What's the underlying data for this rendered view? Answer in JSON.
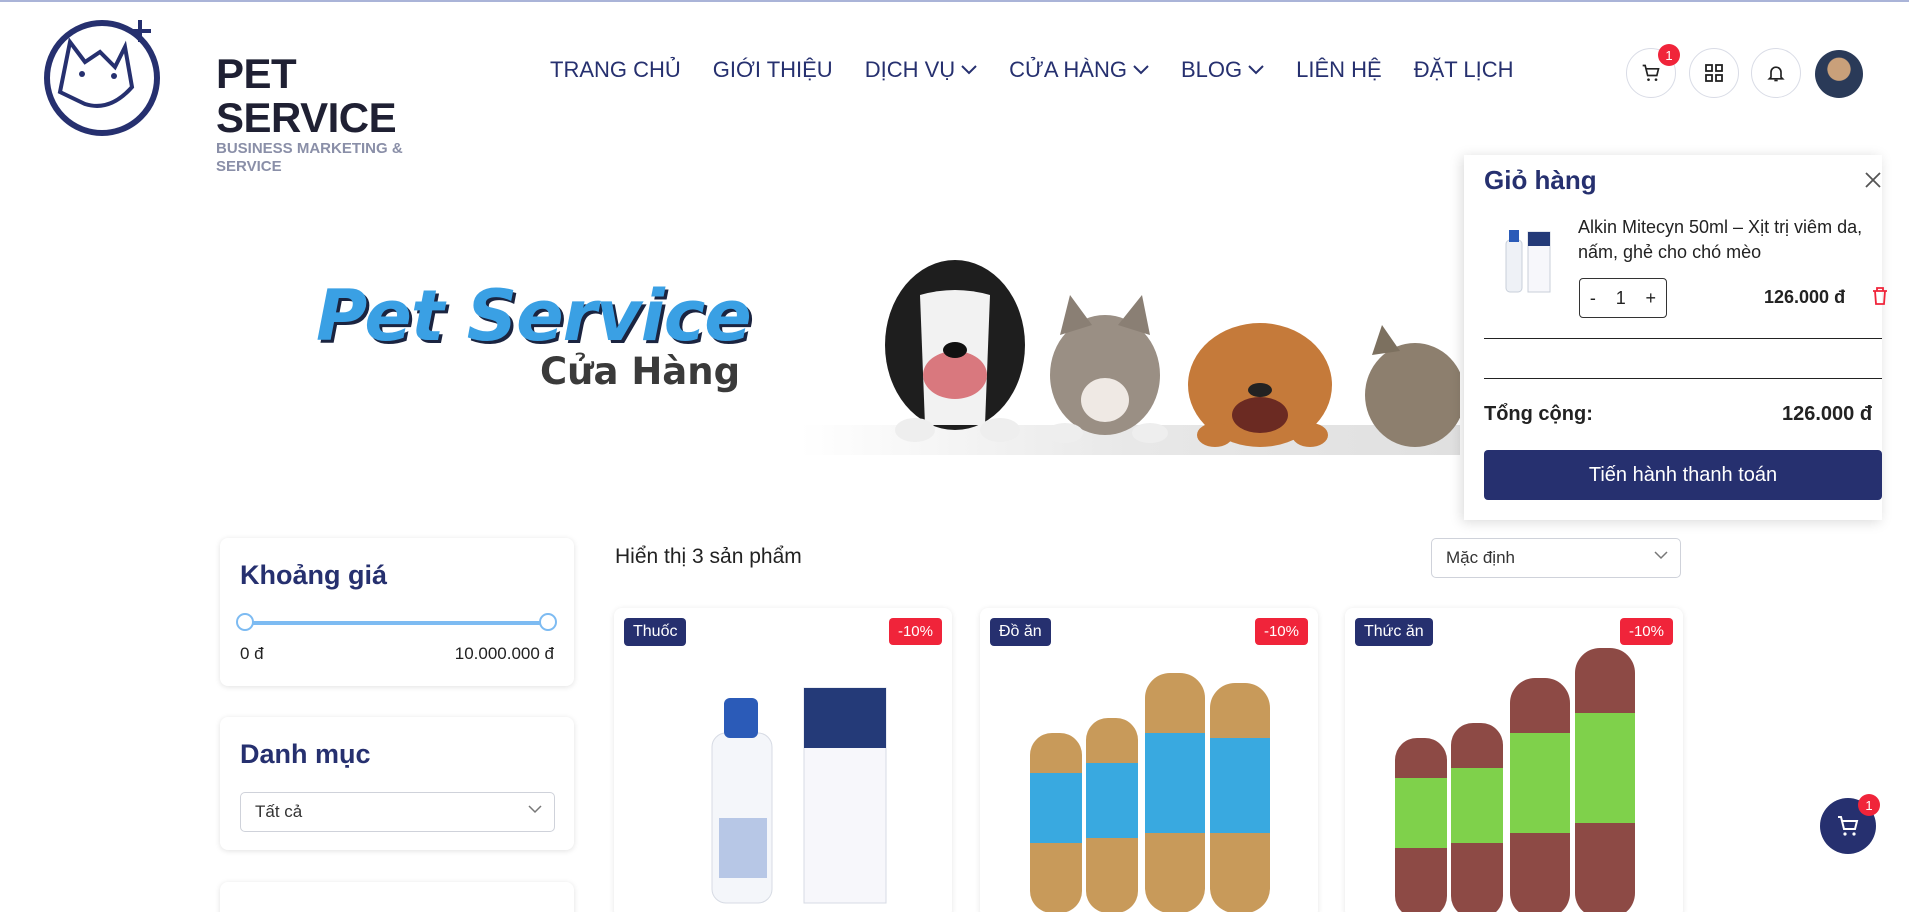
{
  "brand": {
    "title": "PET SERVICE",
    "subtitle": "BUSINESS MARKETING & SERVICE"
  },
  "nav": {
    "items": [
      {
        "label": "TRANG CHỦ",
        "has_dropdown": false
      },
      {
        "label": "GIỚI THIỆU",
        "has_dropdown": false
      },
      {
        "label": "DỊCH VỤ",
        "has_dropdown": true
      },
      {
        "label": "CỬA HÀNG",
        "has_dropdown": true
      },
      {
        "label": "BLOG",
        "has_dropdown": true
      },
      {
        "label": "LIÊN HỆ",
        "has_dropdown": false
      },
      {
        "label": "ĐẶT LỊCH",
        "has_dropdown": false
      }
    ]
  },
  "header_actions": {
    "cart_count": "1",
    "icons": [
      "cart-icon",
      "grid-icon",
      "bell-icon",
      "avatar"
    ]
  },
  "hero": {
    "title": "Pet Service",
    "subtitle": "Cửa Hàng"
  },
  "filters": {
    "price": {
      "title": "Khoảng giá",
      "min_label": "0 đ",
      "max_label": "10.000.000 đ",
      "range_fraction": [
        0,
        1
      ]
    },
    "category": {
      "title": "Danh mục",
      "selected": "Tất cả"
    }
  },
  "products": {
    "count_text": "Hiển thị 3 sản phẩm",
    "sort_selected": "Mặc định",
    "items": [
      {
        "category": "Thuốc",
        "discount": "-10%"
      },
      {
        "category": "Đồ ăn",
        "discount": "-10%"
      },
      {
        "category": "Thức ăn",
        "discount": "-10%"
      }
    ]
  },
  "cart": {
    "title": "Giỏ hàng",
    "item": {
      "name": "Alkin Mitecyn 50ml – Xịt trị viêm da, nấm, ghẻ cho chó mèo",
      "quantity": "1",
      "minus": "-",
      "plus": "+",
      "price": "126.000 đ"
    },
    "total_label": "Tổng cộng:",
    "total_value": "126.000 đ",
    "checkout_label": "Tiến hành thanh toán"
  },
  "floating_cart": {
    "count": "1"
  },
  "colors": {
    "primary": "#26306f",
    "accent_blue": "#3aa0e4",
    "danger": "#f0243a"
  }
}
